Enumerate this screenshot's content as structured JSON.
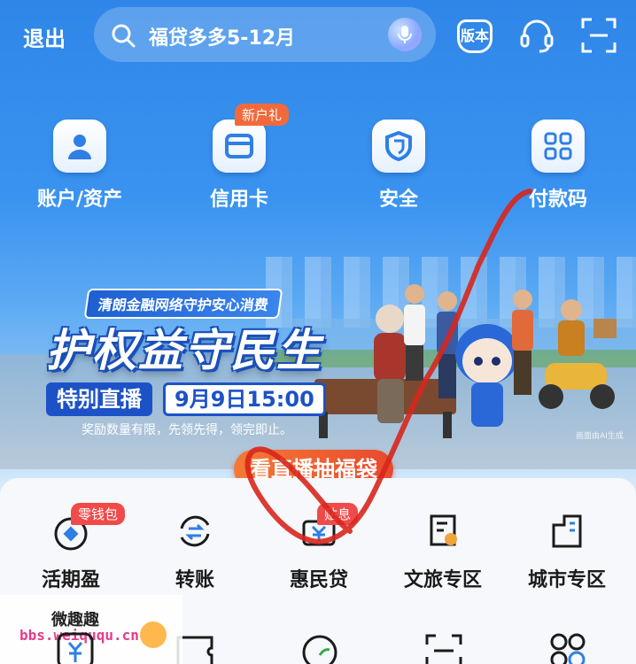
{
  "topbar": {
    "logout_label": "退出",
    "search_placeholder": "福贷多多5-12月",
    "icons": [
      "search-icon",
      "voice-icon",
      "version-icon",
      "customer-service-icon",
      "scan-icon"
    ],
    "version_label": "版本"
  },
  "quick_entries": [
    {
      "label": "账户/资产",
      "icon": "person-icon"
    },
    {
      "label": "信用卡",
      "icon": "card-icon",
      "badge": "新户礼"
    },
    {
      "label": "安全",
      "icon": "shield-icon"
    },
    {
      "label": "付款码",
      "icon": "qr-code-icon"
    }
  ],
  "banner": {
    "subtitle": "清朗金融网络守护安心消费",
    "title": "护权益守民生",
    "live_label": "特别直播",
    "datetime": "9月9日15:00",
    "note": "奖励数量有限，先领先得，领完即止。",
    "image_credit": "画面由AI生成",
    "cta_label": "看直播抽福袋"
  },
  "services": [
    {
      "label": "活期盈",
      "icon": "coin-icon",
      "badge": "零钱包"
    },
    {
      "label": "转账",
      "icon": "transfer-icon"
    },
    {
      "label": "惠民贷",
      "icon": "loan-icon",
      "badge": "贴息"
    },
    {
      "label": "文旅专区",
      "icon": "scroll-icon"
    },
    {
      "label": "城市专区",
      "icon": "building-icon"
    }
  ],
  "watermark": {
    "name": "微趣趣",
    "url": "bbs.weiququ.cn"
  },
  "colors": {
    "brand_blue": "#2f86e8",
    "cta_orange": "#e8492e",
    "badge_red": "#f04a4a",
    "scribble_red": "#d8261c"
  }
}
